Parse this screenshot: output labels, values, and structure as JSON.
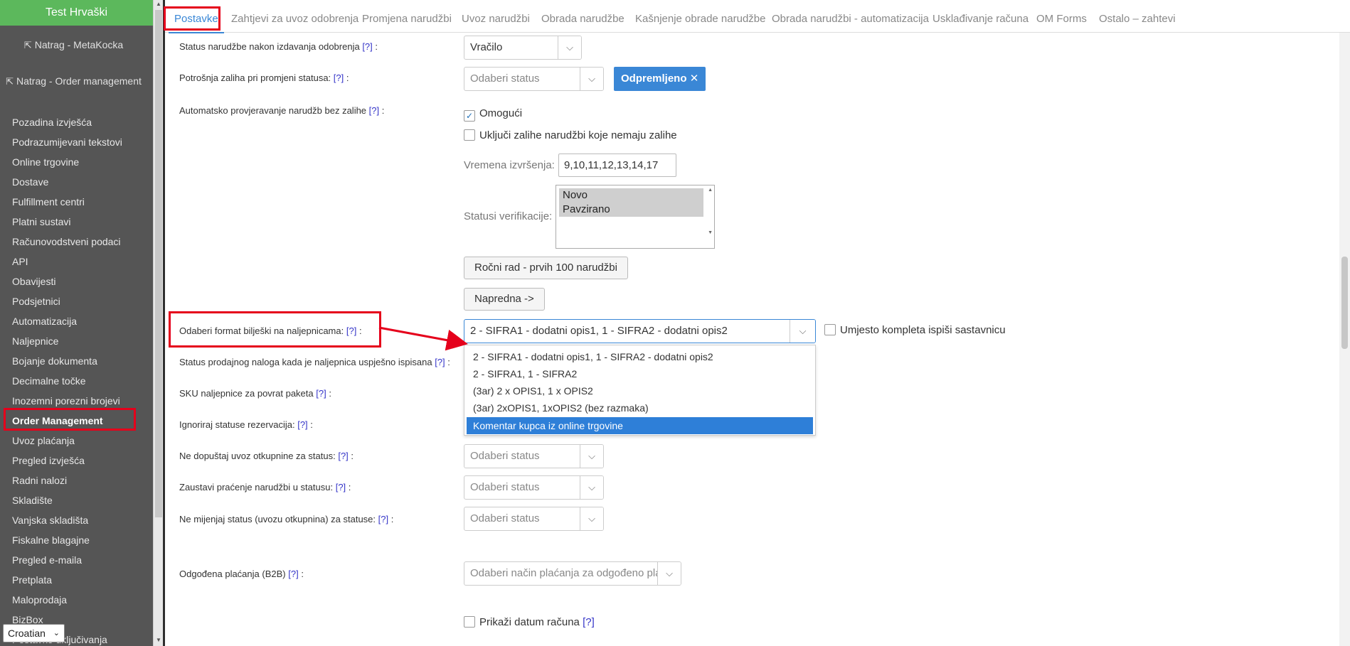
{
  "sidebar": {
    "brand": "Test Hrvaški",
    "back_metakocka": "Natrag - MetaKocka",
    "back_order_mgmt": "Natrag - Order management",
    "items": [
      "Pozadina izvješća",
      "Podrazumijevani tekstovi",
      "Online trgovine",
      "Dostave",
      "Fulfillment centri",
      "Platni sustavi",
      "Računovodstveni podaci",
      "API",
      "Obavijesti",
      "Podsjetnici",
      "Automatizacija",
      "Naljepnice",
      "Bojanje dokumenta",
      "Decimalne točke",
      "Inozemni porezni brojevi",
      "Order Management",
      "Uvoz plaćanja",
      "Pregled izvješća",
      "Radni nalozi",
      "Skladište",
      "Vanjska skladišta",
      "Fiskalne blagajne",
      "Pregled e-maila",
      "Pretplata",
      "Maloprodaja",
      "BizBox",
      "Postavke uključivanja"
    ],
    "active_item": "Order Management",
    "language": "Croatian"
  },
  "tabs": [
    "Postavke",
    "Zahtjevi za uvoz odobrenja",
    "Promjena narudžbi",
    "Uvoz narudžbi",
    "Obrada narudžbe",
    "Kašnjenje obrade narudžbe",
    "Obrada narudžbi - automatizacija",
    "Usklađivanje računa",
    "OM Forms",
    "Ostalo – zahtevi"
  ],
  "help_marker": "[?]",
  "settings": {
    "status_after_approval": {
      "label": "Status narudžbe nakon izdavanja odobrenja",
      "value": "Vračilo"
    },
    "stock_consumption": {
      "label": "Potrošnja zaliha pri promjeni statusa:",
      "placeholder": "Odaberi status",
      "tag": "Odpremljeno"
    },
    "auto_check": {
      "label": "Automatsko provjeravanje narudžb bez zalihe",
      "enable_label": "Omogući",
      "include_label": "Uključi zalihe narudžbi koje nemaju zalihe",
      "exec_times_label": "Vremena izvršenja:",
      "exec_times_value": "9,10,11,12,13,14,17",
      "verif_label": "Statusi verifikacije:",
      "verif_statuses": [
        "Novo",
        "Pavzirano"
      ],
      "manual_button": "Ročni rad - prvih 100 narudžbi",
      "advanced_button": "Napredna ->"
    },
    "label_note_format": {
      "label": "Odaberi format bilješki na naljepnicama:",
      "value": "2 - SIFRA1 - dodatni opis1, 1 - SIFRA2 - dodatni opis2",
      "bom_checkbox": "Umjesto kompleta ispiši sastavnicu",
      "options": [
        "2 - SIFRA1 - dodatni opis1, 1 - SIFRA2 - dodatni opis2",
        "2 - SIFRA1, 1 - SIFRA2",
        "(3ar) 2 x OPIS1, 1 x OPIS2",
        "(3ar) 2xOPIS1, 1xOPIS2 (bez razmaka)",
        "Komentar kupca iz online trgovine"
      ],
      "highlighted_option": "Komentar kupca iz online trgovine"
    },
    "sales_order_status_label": "Status prodajnog naloga kada je naljepnica uspješno ispisana",
    "return_sku_label": "SKU naljepnice za povrat paketa",
    "ignore_reservation_label": "Ignoriraj statuse rezervacija:",
    "no_cod_import": {
      "label": "Ne dopuštaj uvoz otkupnine za status:",
      "placeholder": "Odaberi status"
    },
    "stop_tracking": {
      "label": "Zaustavi praćenje narudžbi u statusu:",
      "placeholder": "Odaberi status"
    },
    "no_status_change": {
      "label": "Ne mijenjaj status (uvozu otkupnina) za statuse:",
      "placeholder": "Odaberi status"
    },
    "deferred_payment": {
      "label": "Odgođena plaćanja (B2B)",
      "placeholder": "Odaberi način plaćanja za odgođeno plaćanje"
    },
    "show_invoice_date": "Prikaži datum računa"
  },
  "accent_colors": {
    "brand_green": "#5cb85c",
    "primary_blue": "#3a87d6",
    "annotation_red": "#e5001b"
  }
}
